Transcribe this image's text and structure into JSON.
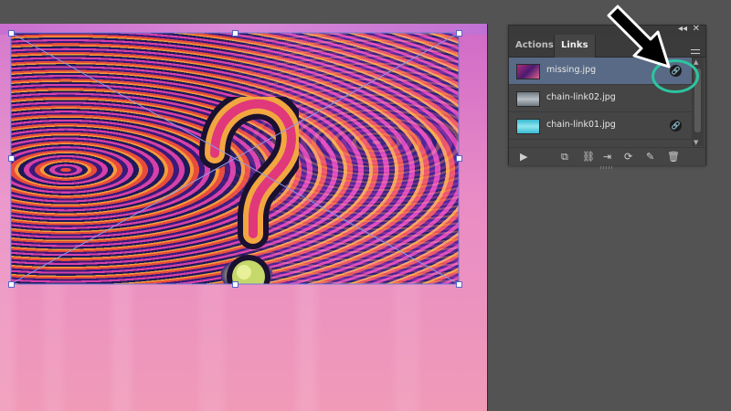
{
  "panel": {
    "tabs": [
      {
        "label": "Actions",
        "active": false
      },
      {
        "label": "Links",
        "active": true
      }
    ],
    "collapse_icon": "double-chevron-icon",
    "close_icon": "close-icon",
    "menu_icon": "hamburger-icon",
    "links": [
      {
        "name": "missing.jpg",
        "selected": true,
        "status": "link-icon",
        "status_glyph": "🔗"
      },
      {
        "name": "chain-link02.jpg",
        "selected": false
      },
      {
        "name": "chain-link01.jpg",
        "selected": false,
        "status": "link-icon",
        "status_glyph": "🔗"
      }
    ],
    "footer_buttons": [
      {
        "name": "show-import-options-icon",
        "glyph": "▶"
      },
      {
        "name": "relink-from-cc-icon",
        "glyph": "⧉"
      },
      {
        "name": "relink-icon",
        "glyph": "⛓"
      },
      {
        "name": "go-to-link-icon",
        "glyph": "⇥"
      },
      {
        "name": "update-link-icon",
        "glyph": "⟳"
      },
      {
        "name": "edit-original-icon",
        "glyph": "✎"
      },
      {
        "name": "trash-icon",
        "glyph": "🗑"
      }
    ]
  },
  "colors": {
    "annotation_circle": "#2cc5a0",
    "selected_row": "#586a85",
    "workspace": "#535353"
  }
}
